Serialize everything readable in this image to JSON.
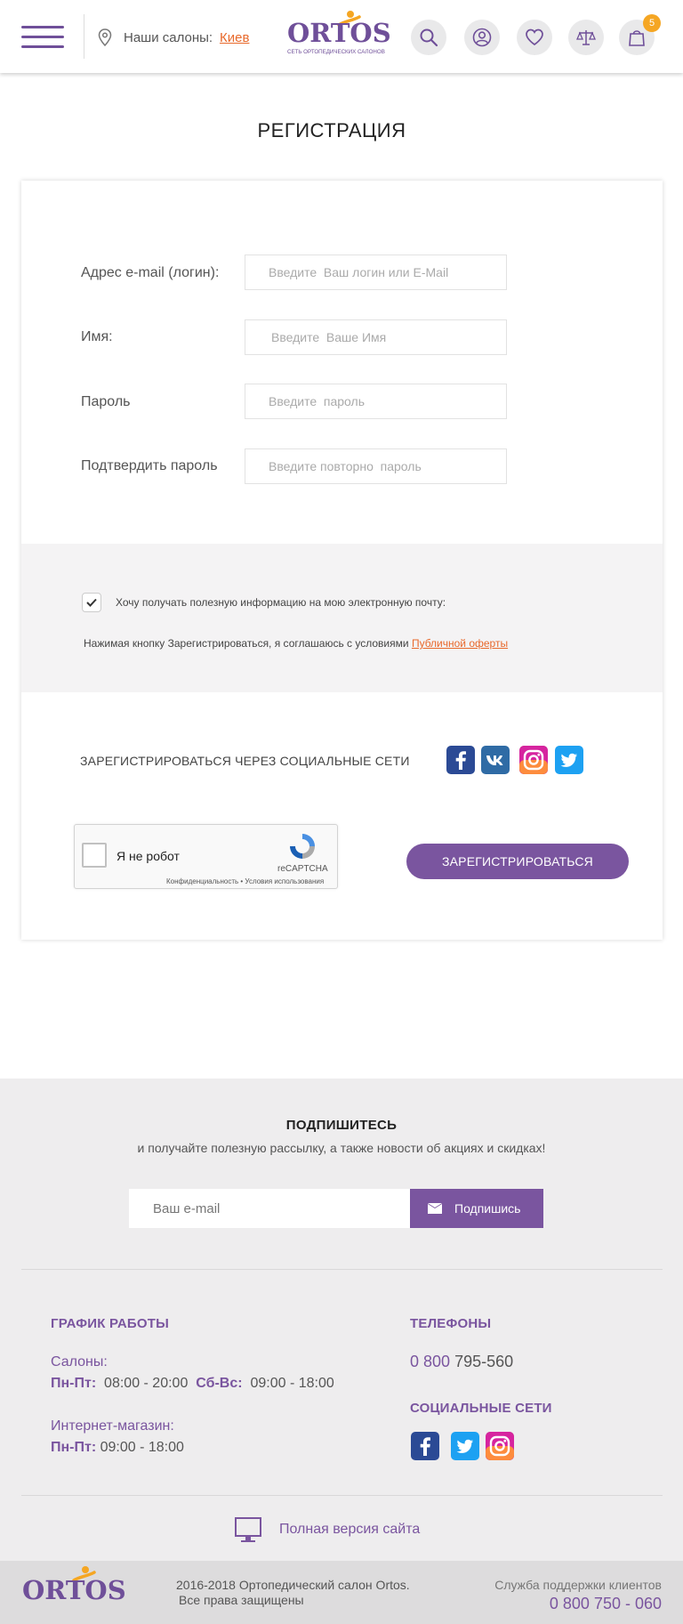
{
  "header": {
    "salons_label": "Наши салоны:",
    "city": "Киев",
    "logo_text": "ORTOS",
    "logo_subtitle": "СЕТЬ ОРТОПЕДИЧЕСКИХ САЛОНОВ",
    "cart_count": "5"
  },
  "page": {
    "title": "РЕГИСТРАЦИЯ"
  },
  "form": {
    "email_label": "Адрес e-mail (логин):",
    "email_placeholder": "Введите  Ваш логин или E-Mail",
    "name_label": "Имя:",
    "name_placeholder": "Введите  Ваше Имя",
    "password_label": "Пароль",
    "password_placeholder": "Введите  пароль",
    "confirm_label": "Подтвердить пароль",
    "confirm_placeholder": "Введите повторно  пароль",
    "newsletter_label": "Хочу получать полезную информацию на мою электронную почту:",
    "newsletter_checked": true,
    "terms_text": "Нажимая кнопку Зарегистрироваться, я соглашаюсь с условиями",
    "terms_link": "Публичной оферты",
    "social_label": "ЗАРЕГИСТРИРОВАТЬСЯ  ЧЕРЕЗ СОЦИАЛЬНЫЕ СЕТИ",
    "recaptcha_label": "Я не робот",
    "recaptcha_brand": "reCAPTCHA",
    "recaptcha_links": "Конфиденциальность • Условия использования",
    "submit_label": "ЗАРЕГИСТРИРОВАТЬСЯ"
  },
  "subscribe": {
    "title": "ПОДПИШИТЕСЬ",
    "text": "и получайте полезную рассылку, а также новости об акциях и скидках!",
    "placeholder": "Ваш e-mail",
    "button": "Подпишись"
  },
  "footer": {
    "schedule_title": "ГРАФИК РАБОТЫ",
    "salons_label": "Салоны:",
    "weekdays_label": "Пн-Пт:",
    "weekdays_hours": "08:00 - 20:00",
    "weekend_label": "Сб-Вс:",
    "weekend_hours": "09:00 - 18:00",
    "shop_label": "Интернет-магазин:",
    "shop_days_label": "Пн-Пт:",
    "shop_hours": "09:00 - 18:00",
    "phones_title": "ТЕЛЕФОНЫ",
    "phone_prefix": "0 800",
    "phone_number": "795-560",
    "socials_title": "СОЦИАЛЬНЫЕ СЕТИ",
    "full_version": "Полная версия сайта",
    "copyright_line1": "2016-2018  Ортопедический салон Ortos.",
    "copyright_line2": "Все права защищены",
    "support_label": "Служба поддержки клиентов",
    "support_phone": "0 800 750 - 060",
    "logo_text": "ORTOS"
  },
  "colors": {
    "brand": "#7a559f",
    "accent": "#e8692b",
    "badge": "#f5a623"
  }
}
